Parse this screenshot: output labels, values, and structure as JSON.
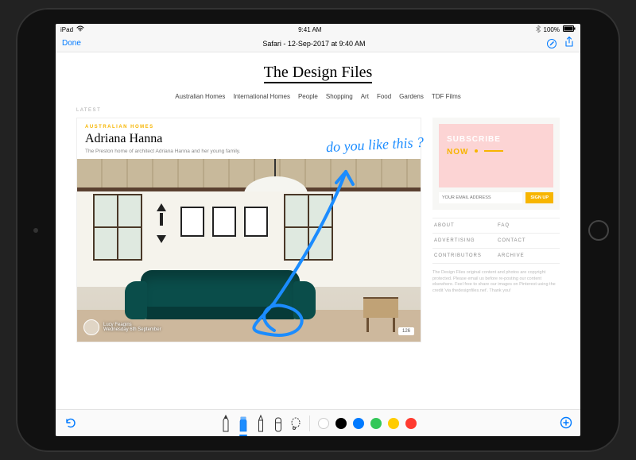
{
  "status": {
    "device": "iPad",
    "wifi": "●●●",
    "time": "9:41 AM",
    "bluetooth": "ᚼ",
    "battery_pct": "100%"
  },
  "nav": {
    "done": "Done",
    "title": "Safari - 12-Sep-2017 at 9:40 AM"
  },
  "site": {
    "logo": "The Design Files",
    "menu": [
      "Australian Homes",
      "International Homes",
      "People",
      "Shopping",
      "Art",
      "Food",
      "Gardens",
      "TDF Films"
    ],
    "latest": "LATEST"
  },
  "article": {
    "category": "AUSTRALIAN HOMES",
    "title": "Adriana Hanna",
    "subtitle": "The Preston home of architect Adriana Hanna and her young family.",
    "author_name": "Lucy Feagins",
    "author_sub": "Wednesday 6th September",
    "badge": "126"
  },
  "sidebar": {
    "subscribe": "SUBSCRIBE",
    "now": "NOW",
    "email_placeholder": "YOUR EMAIL ADDRESS",
    "signup": "SIGN UP",
    "links": [
      "ABOUT",
      "FAQ",
      "ADVERTISING",
      "CONTACT",
      "CONTRIBUTORS",
      "ARCHIVE"
    ],
    "footer": "The Design Files original content and photos are copyright protected. Please email us before re-posting our content elsewhere. Feel free to share our images on Pinterest using the credit 'via thedesignfiles.net'. Thank you!"
  },
  "annotation": "do you like this ?",
  "toolbar": {
    "colors": [
      "#ffffff",
      "#000000",
      "#007aff",
      "#34c759",
      "#ffcc00",
      "#ff3b30"
    ],
    "selected_color_index": 2
  }
}
